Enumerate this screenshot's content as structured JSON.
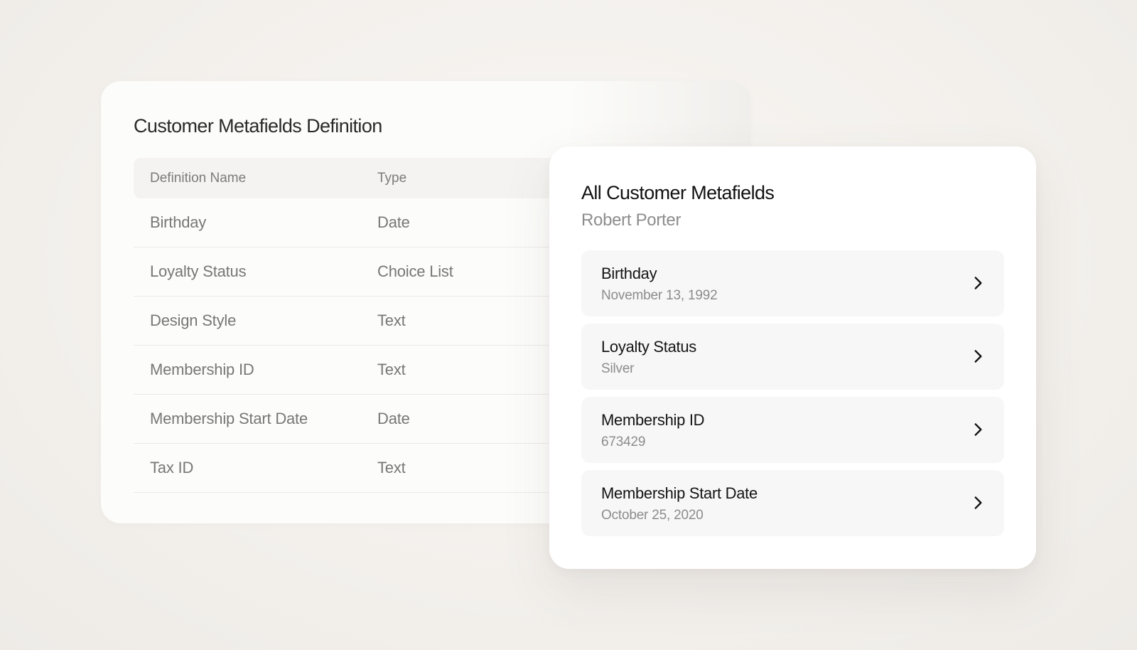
{
  "definitions_card": {
    "title": "Customer Metafields Definition",
    "columns": [
      "Definition Name",
      "Type"
    ],
    "rows": [
      {
        "name": "Birthday",
        "type": "Date"
      },
      {
        "name": "Loyalty Status",
        "type": "Choice List"
      },
      {
        "name": "Design Style",
        "type": "Text"
      },
      {
        "name": "Membership ID",
        "type": "Text"
      },
      {
        "name": "Membership Start Date",
        "type": "Date"
      },
      {
        "name": "Tax ID",
        "type": "Text"
      }
    ]
  },
  "values_card": {
    "title": "All Customer Metafields",
    "customer_name": "Robert Porter",
    "items": [
      {
        "label": "Birthday",
        "value": "November 13, 1992",
        "icon": "chevron-right-icon"
      },
      {
        "label": "Loyalty Status",
        "value": "Silver",
        "icon": "chevron-right-icon"
      },
      {
        "label": "Membership ID",
        "value": "673429",
        "icon": "chevron-right-icon"
      },
      {
        "label": "Membership Start Date",
        "value": "October 25, 2020",
        "icon": "chevron-right-icon"
      }
    ]
  },
  "colors": {
    "background": "#f3f0ec",
    "card": "#ffffff",
    "muted_text": "#8c8c8c",
    "strong_text": "#141414"
  }
}
